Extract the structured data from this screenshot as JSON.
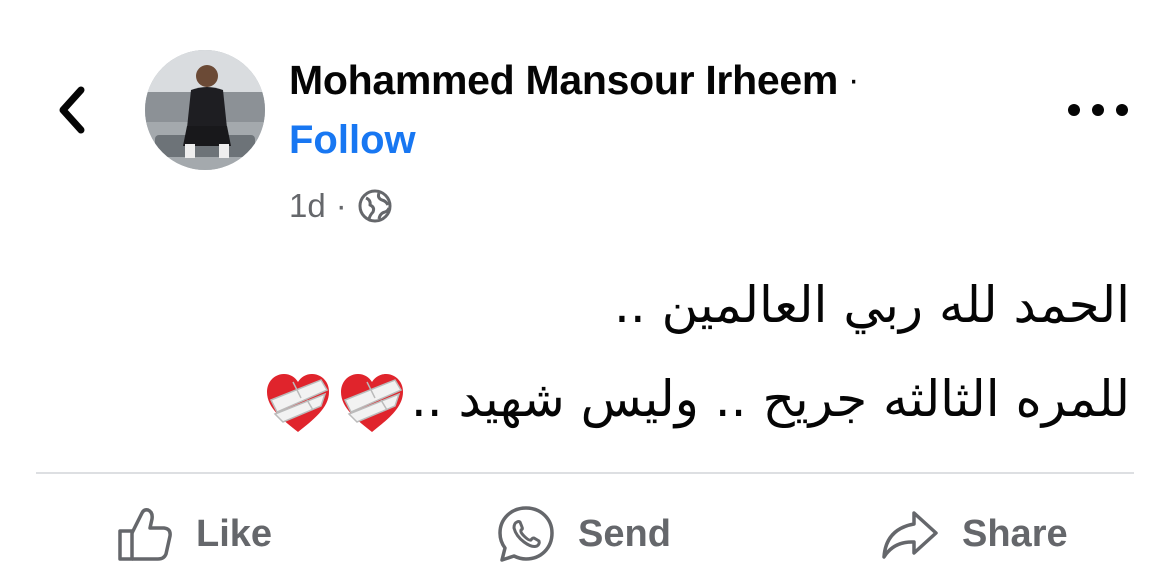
{
  "header": {
    "author_name": "Mohammed Mansour Irheem",
    "name_separator": "·",
    "follow_label": "Follow",
    "timestamp": "1d",
    "meta_separator": "·",
    "audience_icon": "globe-icon",
    "back_icon": "chevron-left-icon",
    "more_icon": "more-horizontal-icon"
  },
  "post": {
    "line1": "الحمد لله ربي العالمين ..",
    "line2": "للمره الثالثه جريح .. وليس شهيد ..",
    "emoji": [
      "mending-heart",
      "mending-heart"
    ]
  },
  "actions": {
    "like_label": "Like",
    "send_label": "Send",
    "share_label": "Share"
  },
  "colors": {
    "link": "#1877f2",
    "text": "#050505",
    "secondary": "#65676b",
    "divider": "#dddfe2"
  }
}
